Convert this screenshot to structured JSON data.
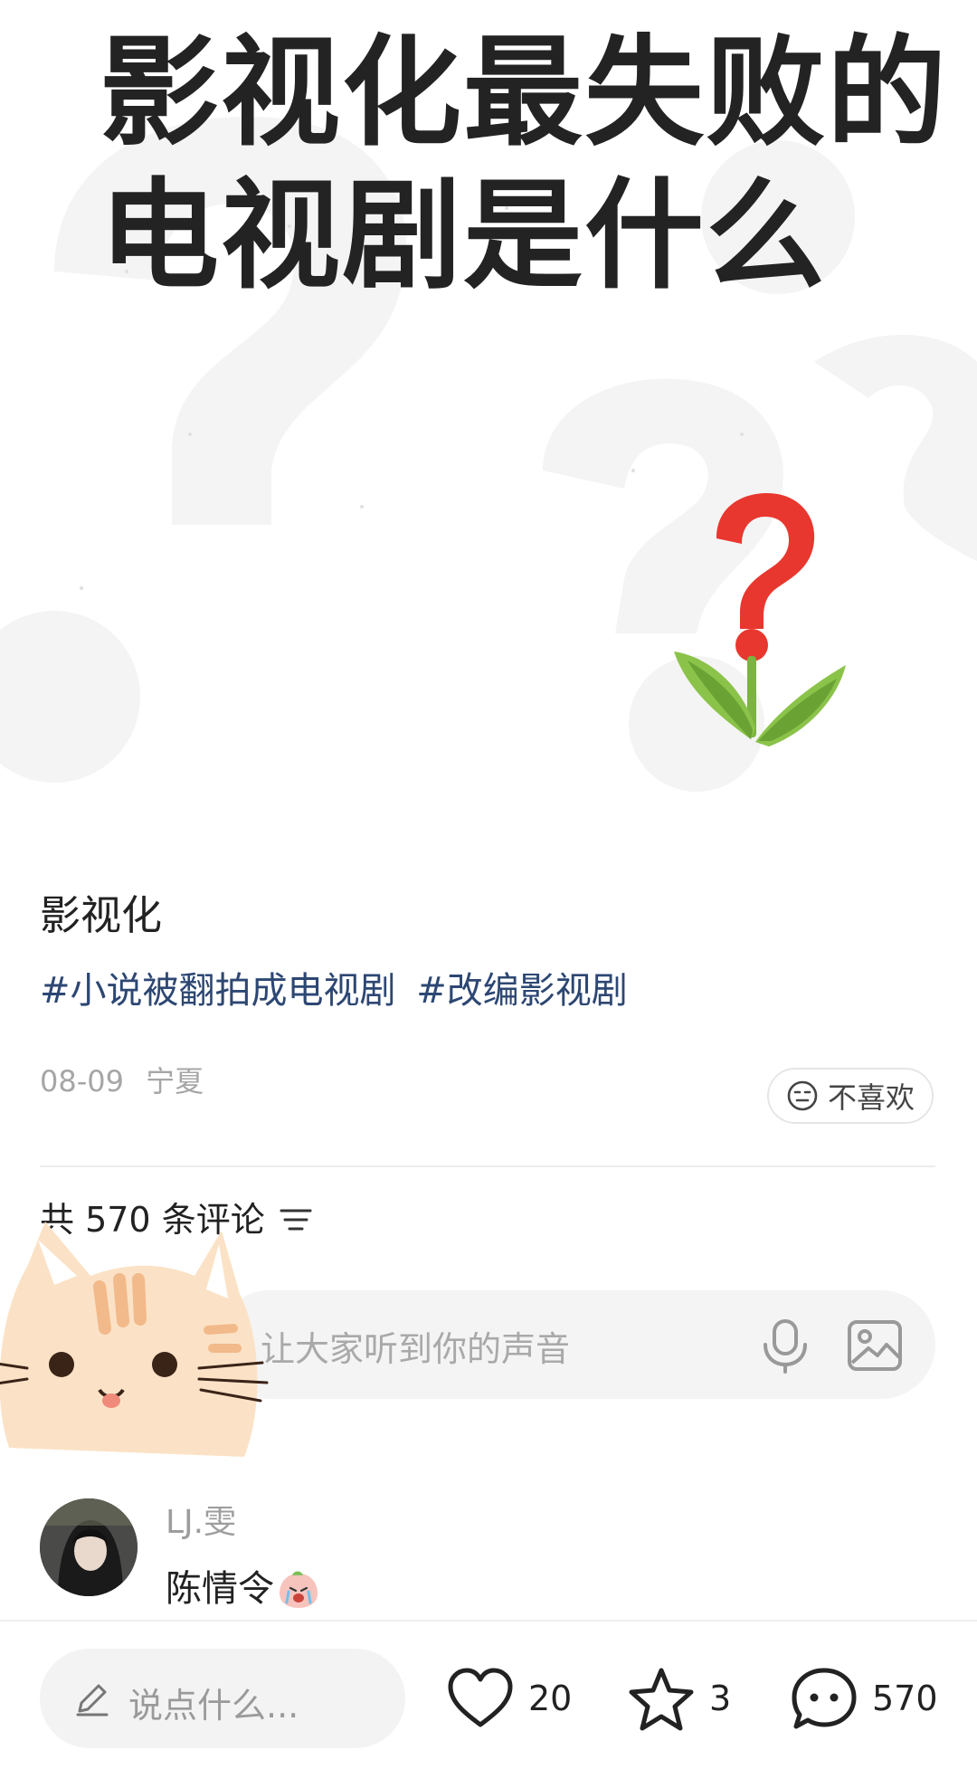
{
  "hero": {
    "title_line1_a": "影视化最",
    "title_line1_hl": "失败",
    "title_line1_b": "的",
    "title_line2": "电视剧是什么",
    "highlight_color": "#c9ef59"
  },
  "post": {
    "title": "影视化",
    "tags": [
      "#小说被翻拍成电视剧",
      "#改编影视剧"
    ],
    "date": "08-09",
    "location": "宁夏",
    "dislike_label": "不喜欢"
  },
  "comments": {
    "count_label": "共 570 条评论",
    "input_placeholder": "让大家听到你的声音",
    "first": {
      "username": "LJ.雯",
      "text": "陈情令"
    }
  },
  "bottom_bar": {
    "input_placeholder": "说点什么...",
    "like_count": "20",
    "favorite_count": "3",
    "comment_count": "570"
  },
  "icons": {
    "dislike": "neutral-face-icon",
    "sort": "filter-lines-icon",
    "mic": "microphone-icon",
    "image": "image-icon",
    "edit": "pencil-icon",
    "like": "heart-icon",
    "favorite": "star-icon",
    "reply": "chat-bubble-icon"
  }
}
